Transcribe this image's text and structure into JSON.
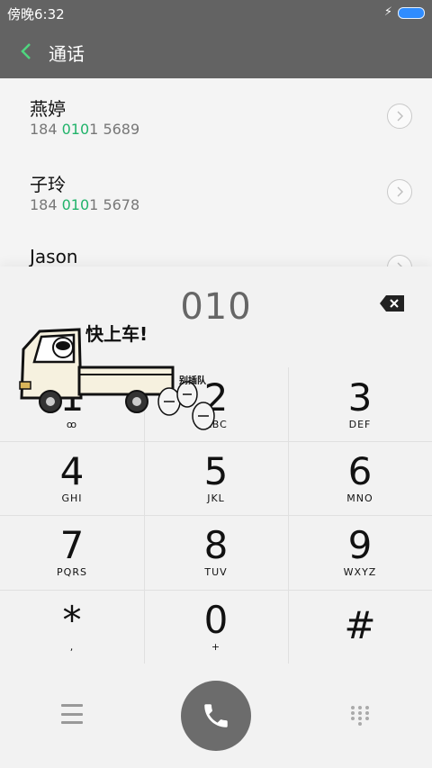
{
  "status": {
    "time": "傍晚6:32"
  },
  "header": {
    "title": "通话"
  },
  "contacts": [
    {
      "name": "燕婷",
      "number_prefix": "184 ",
      "number_match": "010",
      "number_suffix": "1 5689"
    },
    {
      "name": "子玲",
      "number_prefix": "184 ",
      "number_match": "010",
      "number_suffix": "1 5678"
    },
    {
      "name": "Jason",
      "number_prefix": "",
      "number_match": "",
      "number_suffix": ""
    }
  ],
  "dialer": {
    "dialed": "010",
    "keys": [
      {
        "digit": "1",
        "letters": "ꝏ"
      },
      {
        "digit": "2",
        "letters": "ABC"
      },
      {
        "digit": "3",
        "letters": "DEF"
      },
      {
        "digit": "4",
        "letters": "GHI"
      },
      {
        "digit": "5",
        "letters": "JKL"
      },
      {
        "digit": "6",
        "letters": "MNO"
      },
      {
        "digit": "7",
        "letters": "PQRS"
      },
      {
        "digit": "8",
        "letters": "TUV"
      },
      {
        "digit": "9",
        "letters": "WXYZ"
      },
      {
        "digit": "*",
        "letters": ","
      },
      {
        "digit": "0",
        "letters": "+"
      },
      {
        "digit": "#",
        "letters": ""
      }
    ]
  },
  "sticker": {
    "caption": "快上车!",
    "small": "别插队"
  },
  "colors": {
    "header": "#636363",
    "highlight": "#21b36a",
    "battery": "#2f8cff",
    "call": "#6c6c6c"
  }
}
